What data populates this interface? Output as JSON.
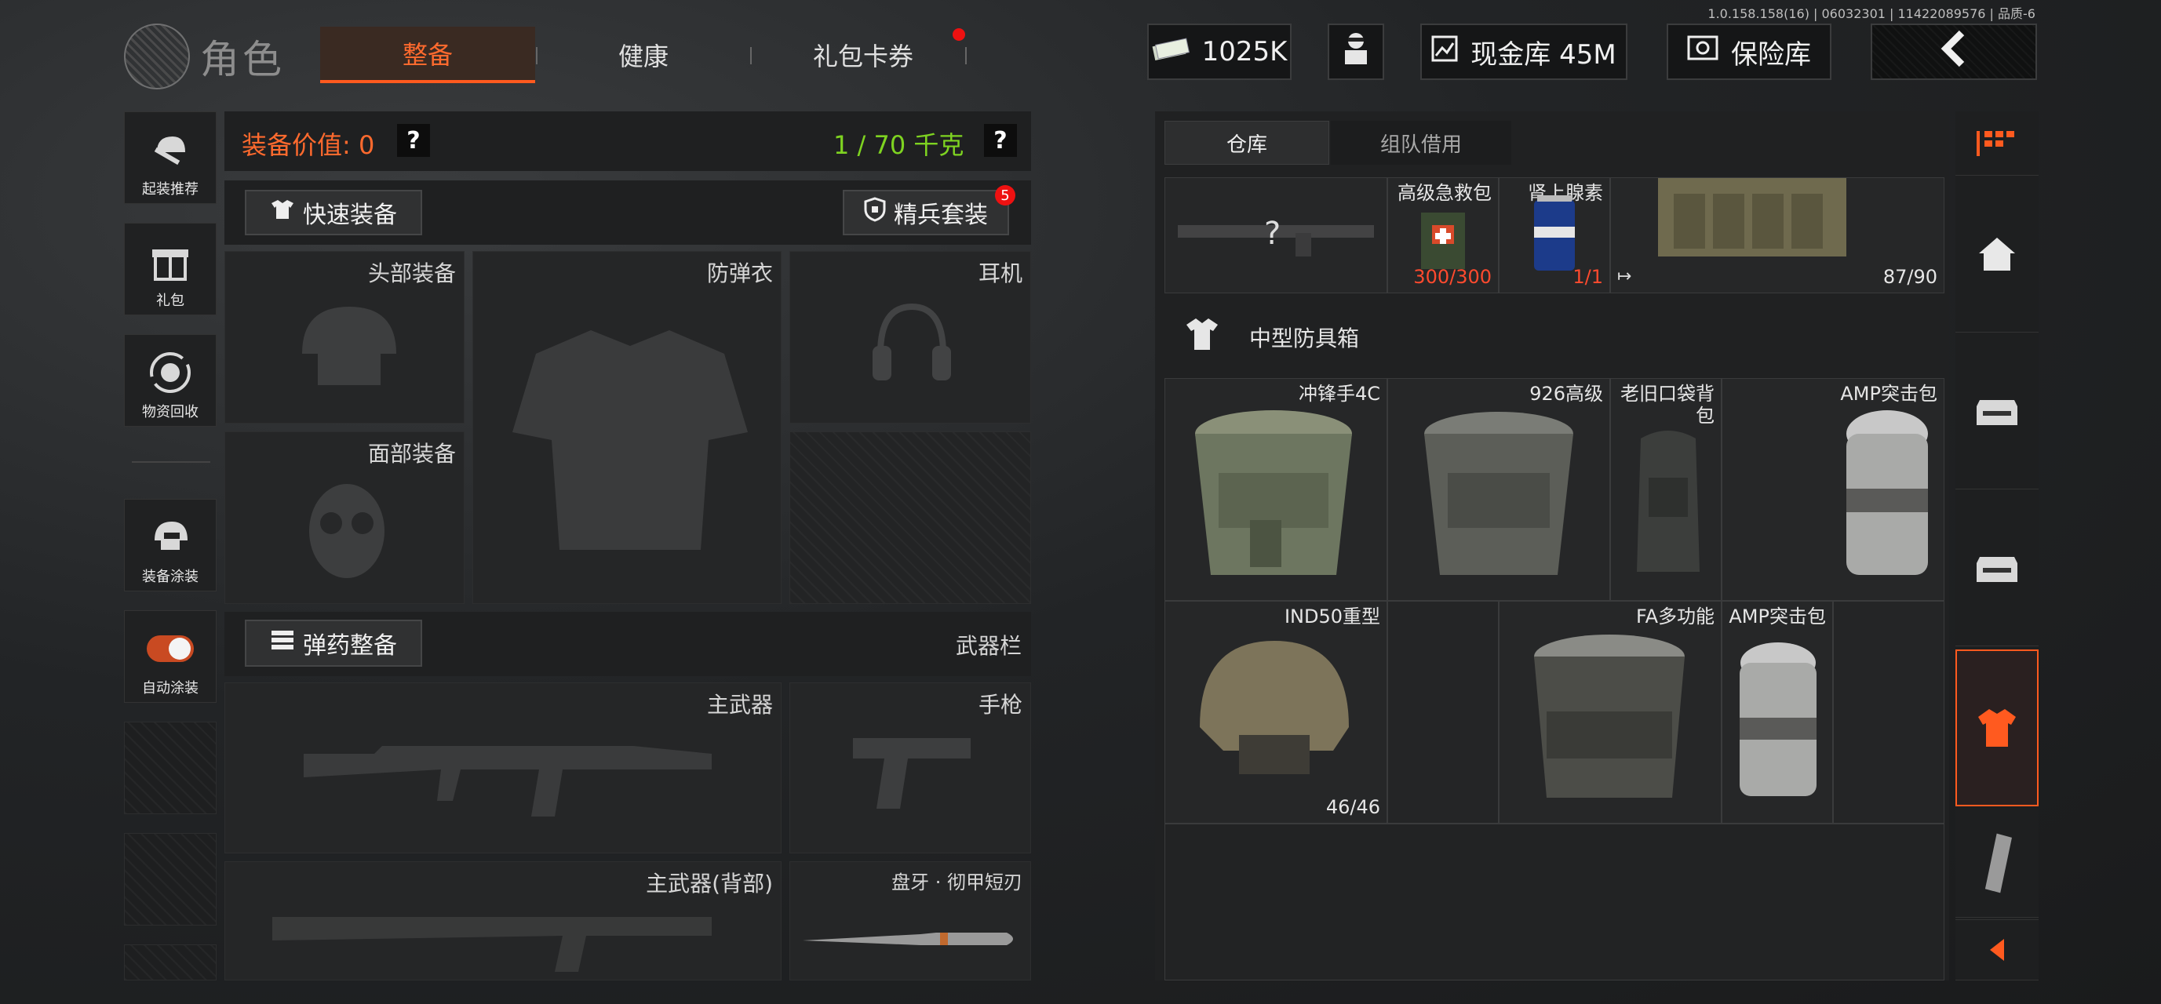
{
  "version": "1.0.158.158(16) | 06032301 | 11422089576 | 品质-6",
  "header": {
    "title": "角色",
    "tabs": [
      {
        "label": "整备"
      },
      {
        "label": "健康"
      },
      {
        "label": "礼包卡券"
      }
    ],
    "currency": "1025K",
    "cash_vault": "现金库 45M",
    "safe_box": "保险库"
  },
  "sidebar": {
    "items": [
      {
        "label": "起装推荐"
      },
      {
        "label": "礼包"
      },
      {
        "label": "物资回收"
      },
      {
        "label": "装备涂装"
      },
      {
        "label": "自动涂装"
      }
    ]
  },
  "equip": {
    "value_label": "装备价值: 0",
    "weight": "1 / 70 千克",
    "quick_equip": "快速装备",
    "elite_set": "精兵套装",
    "elite_badge": "5",
    "head": "头部装备",
    "armor": "防弹衣",
    "headset": "耳机",
    "face": "面部装备",
    "ammo_btn": "弹药整备",
    "weapon_bar": "武器栏",
    "primary": "主武器",
    "pistol": "手枪",
    "primary_back": "主武器(背部)",
    "melee": "盘牙 · 彻甲短刃"
  },
  "warehouse": {
    "tabs": [
      {
        "label": "仓库"
      },
      {
        "label": "组队借用"
      }
    ],
    "top_row": [
      {
        "name": "",
        "count": "",
        "unknown": "?"
      },
      {
        "name": "高级急救包",
        "count": "300/300"
      },
      {
        "name": "肾上腺素",
        "count": "1/1"
      },
      {
        "name": "",
        "count": "87/90"
      }
    ],
    "section_title": "中型防具箱",
    "items": [
      {
        "name": "冲锋手4C",
        "count": ""
      },
      {
        "name": "926高级",
        "count": ""
      },
      {
        "name": "老旧口袋背包",
        "count": ""
      },
      {
        "name": "AMP突击包",
        "count": ""
      },
      {
        "name": "IND50重型",
        "count": "46/46"
      },
      {
        "name": "FA多功能",
        "count": ""
      },
      {
        "name": "AMP突击包",
        "count": ""
      }
    ]
  },
  "colors": {
    "accent": "#ff5a1f",
    "weight_green": "#7ed321",
    "value_orange": "#ff6a2e",
    "badge_red": "#e11"
  }
}
